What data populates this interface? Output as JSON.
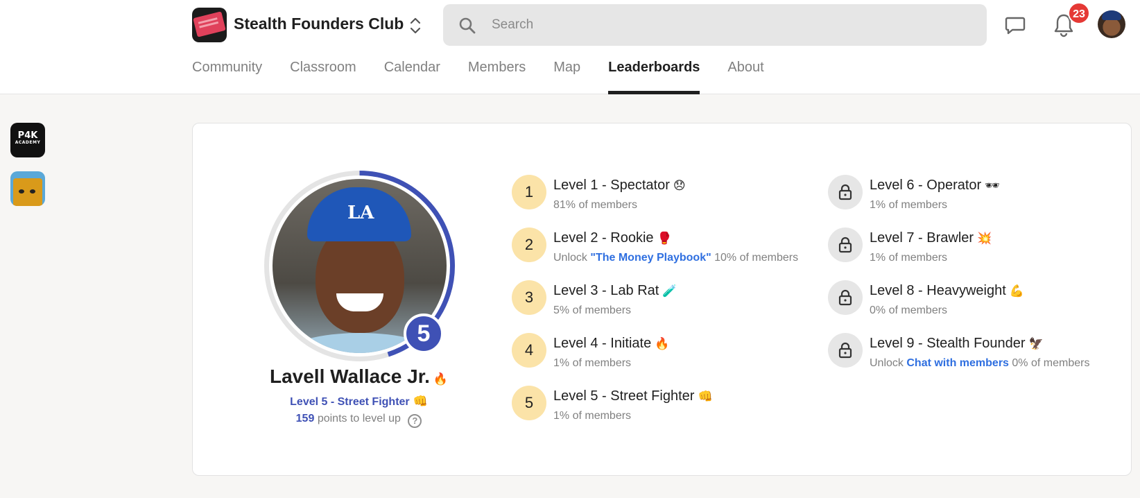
{
  "header": {
    "club_name": "Stealth Founders Club",
    "search_placeholder": "Search",
    "notification_count": "23"
  },
  "tabs": [
    {
      "label": "Community"
    },
    {
      "label": "Classroom"
    },
    {
      "label": "Calendar"
    },
    {
      "label": "Members"
    },
    {
      "label": "Map"
    },
    {
      "label": "Leaderboards",
      "active": true
    },
    {
      "label": "About"
    }
  ],
  "rail": {
    "apps": [
      {
        "name": "P4K",
        "sub": "ACADEMY"
      },
      {
        "name": "cat-app"
      }
    ]
  },
  "profile": {
    "name": "Lavell Wallace Jr.",
    "name_emoji": "🔥",
    "level_number": "5",
    "level_label": "Level 5 - Street Fighter",
    "level_emoji": "👊",
    "points": "159",
    "points_text": "points to level up",
    "progress": 0.45
  },
  "levels": [
    {
      "num": "1",
      "title": "Level 1 - Spectator",
      "emoji": "😞",
      "unlock_prefix": "",
      "unlock_link": "",
      "percent": "81% of members",
      "locked": false
    },
    {
      "num": "2",
      "title": "Level 2 - Rookie",
      "emoji": "🥊",
      "unlock_prefix": "Unlock",
      "unlock_link": "\"The Money Playbook\"",
      "percent": "10% of members",
      "locked": false
    },
    {
      "num": "3",
      "title": "Level 3 - Lab Rat",
      "emoji": "🧪",
      "unlock_prefix": "",
      "unlock_link": "",
      "percent": "5% of members",
      "locked": false
    },
    {
      "num": "4",
      "title": "Level 4 - Initiate",
      "emoji": "🔥",
      "unlock_prefix": "",
      "unlock_link": "",
      "percent": "1% of members",
      "locked": false
    },
    {
      "num": "5",
      "title": "Level 5 - Street Fighter",
      "emoji": "👊",
      "unlock_prefix": "",
      "unlock_link": "",
      "percent": "1% of members",
      "locked": false
    },
    {
      "num": "6",
      "title": "Level 6 - Operator",
      "emoji": "🕶",
      "unlock_prefix": "",
      "unlock_link": "",
      "percent": "1% of members",
      "locked": true
    },
    {
      "num": "7",
      "title": "Level 7 - Brawler",
      "emoji": "💥",
      "unlock_prefix": "",
      "unlock_link": "",
      "percent": "1% of members",
      "locked": true
    },
    {
      "num": "8",
      "title": "Level 8 - Heavyweight",
      "emoji": "💪",
      "unlock_prefix": "",
      "unlock_link": "",
      "percent": "0% of members",
      "locked": true
    },
    {
      "num": "9",
      "title": "Level 9 - Stealth Founder",
      "emoji": "🦅",
      "unlock_prefix": "Unlock",
      "unlock_link": "Chat with members",
      "percent": "0% of members",
      "locked": true
    }
  ],
  "colors": {
    "accent": "#3f51b5",
    "link": "#2f6fe0",
    "level_circle": "#fbe3a8",
    "badge": "#e53935"
  }
}
